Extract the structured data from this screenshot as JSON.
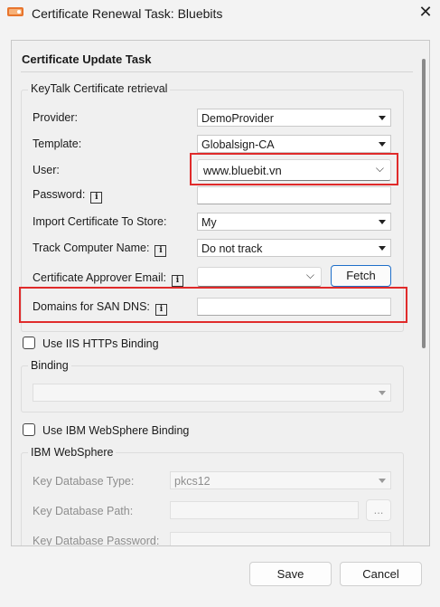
{
  "window": {
    "title": "Certificate Renewal Task: Bluebits",
    "close_glyph": "✕"
  },
  "section": {
    "title": "Certificate Update Task"
  },
  "keytalk": {
    "group_title": "KeyTalk Certificate retrieval",
    "provider": {
      "label": "Provider:",
      "value": "DemoProvider"
    },
    "template": {
      "label": "Template:",
      "value": "Globalsign-CA"
    },
    "user": {
      "label": "User:",
      "value": "www.bluebit.vn"
    },
    "password": {
      "label": "Password:",
      "value": ""
    },
    "import_store": {
      "label": "Import Certificate To Store:",
      "value": "My"
    },
    "track_computer": {
      "label": "Track Computer Name:",
      "value": "Do not track"
    },
    "approver_email": {
      "label": "Certificate Approver Email:",
      "value": ""
    },
    "fetch_label": "Fetch",
    "domains_san": {
      "label": "Domains for SAN DNS:",
      "value": ""
    }
  },
  "iis": {
    "checkbox_label": "Use IIS HTTPs Binding",
    "checked": false,
    "group_title": "Binding",
    "binding_value": ""
  },
  "ibm": {
    "checkbox_label": "Use IBM WebSphere Binding",
    "checked": false,
    "group_title": "IBM WebSphere",
    "key_db_type": {
      "label": "Key Database Type:",
      "value": "pkcs12"
    },
    "key_db_path": {
      "label": "Key Database Path:",
      "value": ""
    },
    "browse_label": "...",
    "key_db_password": {
      "label": "Key Database Password:"
    }
  },
  "footer": {
    "save_label": "Save",
    "cancel_label": "Cancel"
  },
  "colors": {
    "highlight": "#e02b2b",
    "accent": "#1f6fc9"
  },
  "icons": {
    "app": "certificate-app-icon",
    "info": "info-icon",
    "dropdown": "chevron-down-icon"
  }
}
